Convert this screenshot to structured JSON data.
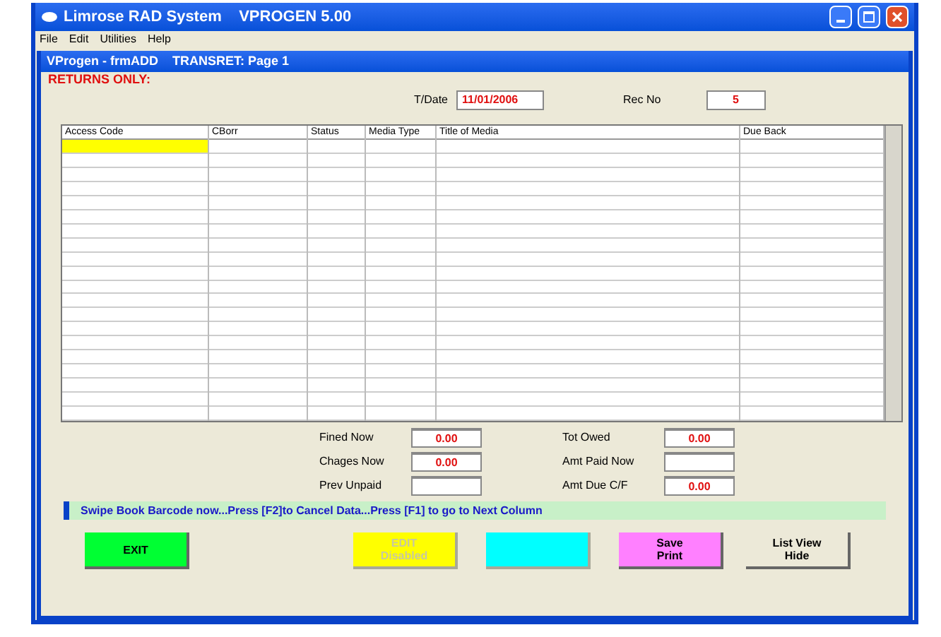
{
  "window": {
    "title": "Limrose RAD System    VPROGEN 5.00"
  },
  "menu": [
    "File",
    "Edit",
    "Utilities",
    "Help"
  ],
  "child_window": {
    "title": "VProgen - frmADD    TRANSRET: Page 1"
  },
  "heading": "RETURNS ONLY:",
  "header_fields": [
    {
      "label": "T/Date",
      "value": "11/01/2006"
    },
    {
      "label": "Rec No",
      "value": "5"
    }
  ],
  "grid": {
    "columns": [
      {
        "label": "Access Code",
        "focused": true
      },
      {
        "label": "CBorr",
        "focused": false
      },
      {
        "label": "Status",
        "focused": false
      },
      {
        "label": "Media Type",
        "focused": false
      },
      {
        "label": "Title of Media",
        "focused": false
      },
      {
        "label": "Due Back",
        "focused": false
      }
    ]
  },
  "totals_left": [
    {
      "label": "Fined Now",
      "value": "0.00"
    },
    {
      "label": "Chages Now",
      "value": "0.00"
    },
    {
      "label": "Prev Unpaid"
    }
  ],
  "totals_right": [
    {
      "label": "Tot Owed",
      "value": "0.00"
    },
    {
      "label": "Amt Paid Now"
    },
    {
      "label": "Amt Due C/F",
      "value": "0.00"
    }
  ],
  "status_message": "Swipe Book Barcode now...Press [F2]to Cancel Data...Press [F1] to go to Next Column",
  "buttons": [
    {
      "lines": [
        "EXIT"
      ],
      "color": "#00ff33",
      "disabled": false
    },
    {
      "lines": [
        "EDIT",
        "Disabled"
      ],
      "color": "#ffff00",
      "disabled": true
    },
    {
      "color": "#00ffff",
      "disabled": true
    },
    {
      "lines": [
        "Save",
        "Print"
      ],
      "color": "#ff80ff",
      "disabled": false
    },
    {
      "lines": [
        "List View",
        "Hide"
      ],
      "color": "#ece9d8",
      "disabled": false
    }
  ]
}
